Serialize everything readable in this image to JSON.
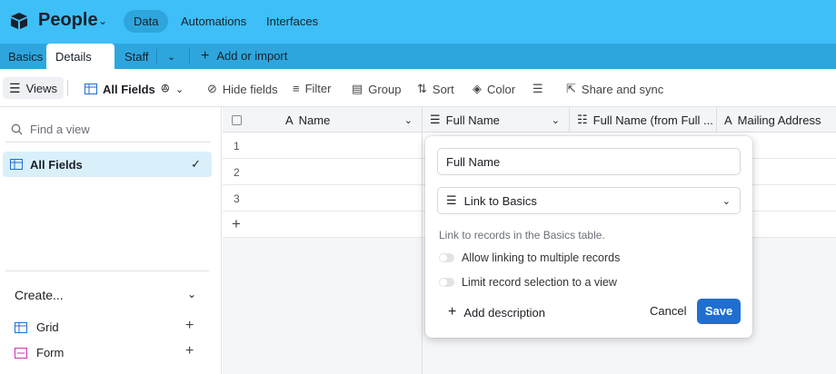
{
  "colors": {
    "topbar": "#3ebff8",
    "tabbar": "#2ea6dd",
    "selected_view": "#d9f0fb",
    "save": "#1f6fd0"
  },
  "app": {
    "base_name": "People"
  },
  "nav": {
    "data": "Data",
    "automations": "Automations",
    "interfaces": "Interfaces"
  },
  "tabs": [
    {
      "label": "Basics"
    },
    {
      "label": "Details"
    },
    {
      "label": "Staff"
    }
  ],
  "tabbar": {
    "add_or_import": "Add or import"
  },
  "toolbar": {
    "views": "Views",
    "current_view": "All Fields",
    "hide_fields": "Hide fields",
    "filter": "Filter",
    "group": "Group",
    "sort": "Sort",
    "color": "Color",
    "share": "Share and sync"
  },
  "sidebar": {
    "find_placeholder": "Find a view",
    "views": [
      {
        "label": "All Fields",
        "icon": "grid-icon",
        "selected": true
      }
    ],
    "create_label": "Create...",
    "create_items": [
      {
        "label": "Grid",
        "icon": "grid-icon"
      },
      {
        "label": "Form",
        "icon": "form-icon"
      }
    ]
  },
  "grid": {
    "columns": [
      {
        "label": "Name",
        "icon": "text-icon"
      },
      {
        "label": "Full Name",
        "icon": "link-icon"
      },
      {
        "label": "Full Name (from Full ...",
        "icon": "lookup-icon"
      },
      {
        "label": "Mailing Address",
        "icon": "text-icon"
      }
    ],
    "rows": [
      "1",
      "2",
      "3"
    ]
  },
  "field_editor": {
    "name_value": "Full Name",
    "type_value": "Link to Basics",
    "hint": "Link to records in the Basics table.",
    "opt_multiple": "Allow linking to multiple records",
    "opt_limit": "Limit record selection to a view",
    "add_description": "Add description",
    "cancel": "Cancel",
    "save": "Save"
  }
}
